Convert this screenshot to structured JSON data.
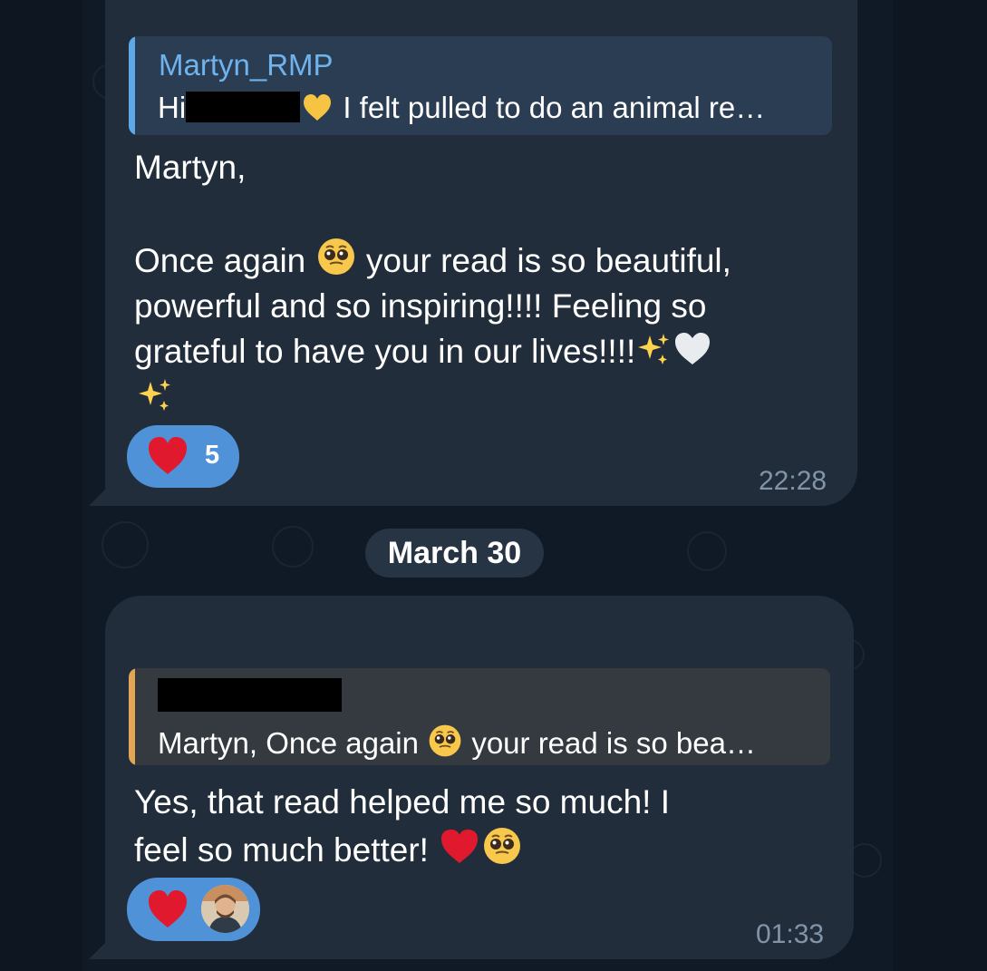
{
  "messages": [
    {
      "reply": {
        "author": "Martyn_RMP",
        "text_prefix": "Hi",
        "text_suffix": " I felt pulled to do an animal re…"
      },
      "body_lines": [
        "Martyn,",
        "",
        "Once again",
        " your read is so beautiful,",
        "powerful and so inspiring!!!! Feeling so",
        "grateful to have you in our lives!!!!"
      ],
      "reaction": {
        "count": "5"
      },
      "time": "22:28"
    },
    {
      "reply": {
        "text_prefix": "Martyn,  Once again",
        "text_suffix": " your read is so bea…"
      },
      "body_lines": [
        "Yes, that read helped me so much! I",
        "feel so much better!"
      ],
      "time": "01:33"
    }
  ],
  "date_separator": "March 30",
  "colors": {
    "background": "#0e1621",
    "bubble": "#212d3b",
    "reply_bg_primary": "#2b3d52",
    "reply_bg_secondary": "#353a40",
    "reply_bar_primary": "#5fa8e8",
    "reply_bar_secondary": "#e3a654",
    "reaction": "#4f92d8",
    "timestamp": "#8294a8"
  },
  "icons": {
    "yellow_heart": "yellow-heart-icon",
    "pleading": "pleading-face-icon",
    "sparkles": "sparkles-icon",
    "white_heart": "white-heart-icon",
    "red_heart": "red-heart-icon",
    "avatar": "reaction-avatar"
  }
}
